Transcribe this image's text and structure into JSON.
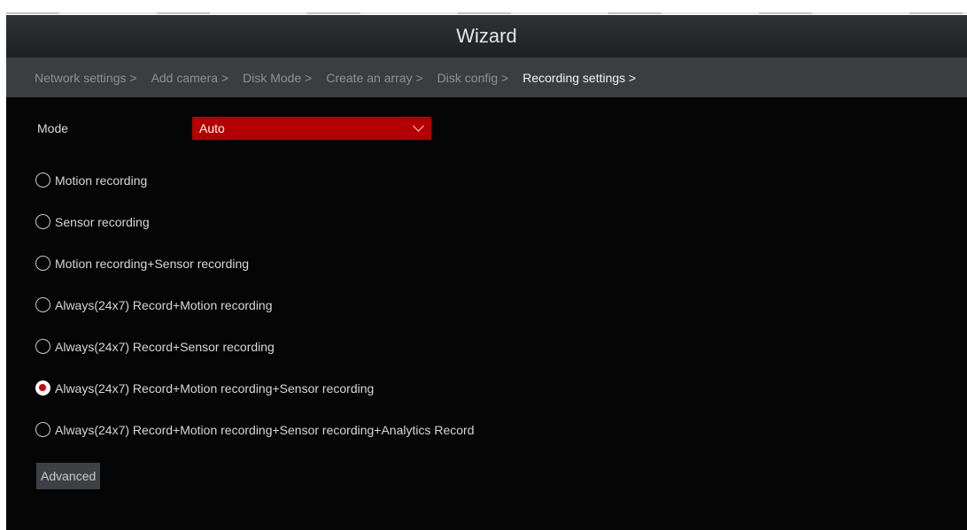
{
  "window": {
    "title": "Wizard"
  },
  "breadcrumb": {
    "steps": [
      {
        "label": "Network settings >"
      },
      {
        "label": "Add camera >"
      },
      {
        "label": "Disk Mode >"
      },
      {
        "label": "Create an array >"
      },
      {
        "label": "Disk config >"
      },
      {
        "label": "Recording settings >"
      }
    ],
    "active_index": 5
  },
  "mode": {
    "label": "Mode",
    "selected": "Auto"
  },
  "recording_options": [
    {
      "label": "Motion recording",
      "checked": false
    },
    {
      "label": "Sensor recording",
      "checked": false
    },
    {
      "label": "Motion recording+Sensor recording",
      "checked": false
    },
    {
      "label": "Always(24x7) Record+Motion recording",
      "checked": false
    },
    {
      "label": "Always(24x7) Record+Sensor recording",
      "checked": false
    },
    {
      "label": "Always(24x7) Record+Motion recording+Sensor recording",
      "checked": true
    },
    {
      "label": "Always(24x7) Record+Motion recording+Sensor recording+Analytics Record",
      "checked": false
    }
  ],
  "advanced_button": {
    "label": "Advanced"
  },
  "colors": {
    "select_bg": "#b40000",
    "radio_checked": "#d40000",
    "breadcrumb_bg": "#3b3d41",
    "window_bg": "#050505"
  }
}
